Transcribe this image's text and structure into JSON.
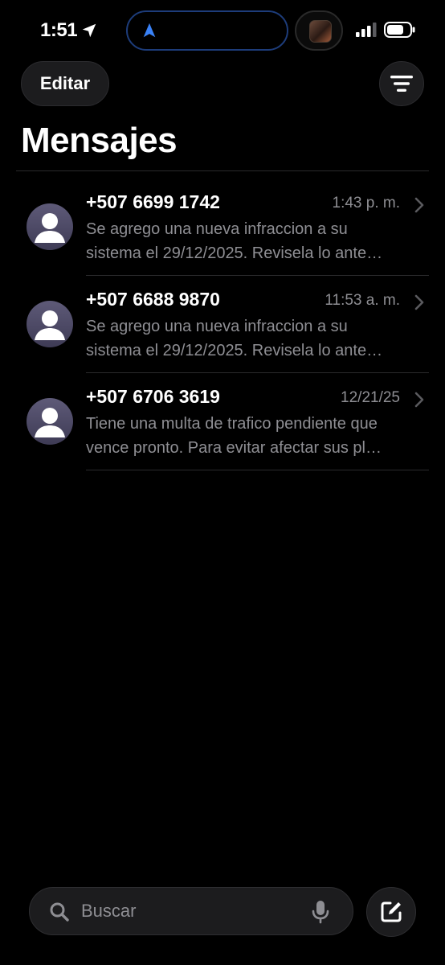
{
  "status_bar": {
    "time": "1:51",
    "icons": [
      "location-arrow-icon",
      "navigation-icon",
      "cellular-signal-icon",
      "battery-icon"
    ]
  },
  "header": {
    "edit_label": "Editar",
    "filter_icon": "filter-icon",
    "title": "Mensajes"
  },
  "conversations": [
    {
      "sender": "+507 6699 1742",
      "time": "1:43 p. m.",
      "preview_line1": "Se agrego una nueva infraccion a su",
      "preview_line2": "sistema el 29/12/2025. Revisela lo ante…"
    },
    {
      "sender": "+507 6688 9870",
      "time": "11:53 a. m.",
      "preview_line1": "Se agrego una nueva infraccion a su",
      "preview_line2": "sistema el 29/12/2025. Revisela lo ante…"
    },
    {
      "sender": "+507 6706 3619",
      "time": "12/21/25",
      "preview_line1": "Tiene una multa de trafico pendiente que",
      "preview_line2": "vence pronto. Para evitar afectar sus pl…"
    }
  ],
  "search": {
    "placeholder": "Buscar",
    "value": ""
  },
  "colors": {
    "background": "#000000",
    "secondary_text": "#8e8e93",
    "button_bg": "#1c1c1e",
    "accent_blue": "#3a82f7"
  }
}
